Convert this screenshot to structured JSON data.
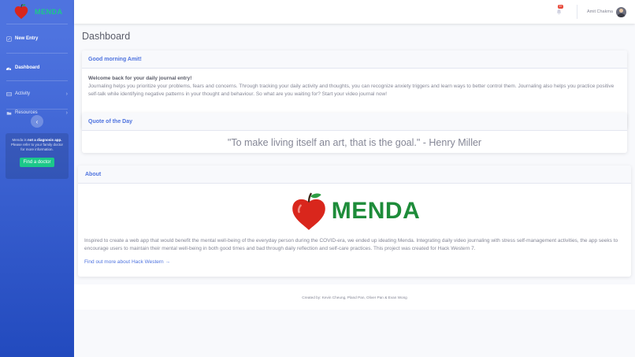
{
  "brand": {
    "name": "MENDA"
  },
  "sidebar": {
    "items": [
      {
        "label": "New Entry",
        "icon": "edit-icon"
      },
      {
        "label": "Dashboard",
        "icon": "tachometer-icon"
      },
      {
        "label": "Activity",
        "icon": "list-icon"
      },
      {
        "label": "Resources",
        "icon": "folder-icon"
      }
    ],
    "notice": {
      "text_prefix": "Menda is ",
      "text_bold": "not a diagnosis app.",
      "text_suffix": " Please refer to your family doctor for more information.",
      "button": "Find a doctor"
    }
  },
  "topbar": {
    "alert_count": "3+",
    "user_name": "Amit Chakma"
  },
  "page": {
    "title": "Dashboard"
  },
  "welcome": {
    "header": "Good morning Amit!",
    "title": "Welcome back for your daily journal entry!",
    "body": "Journaling helps you prioritize your problems, fears and concerns. Through tracking your daily activity and thoughts, you can recognize anxiety triggers and learn ways to better control them. Journaling also helps you practice positive self-talk while identifying negative patterns in your thought and behaviour. So what are you waiting for? Start your video journal now!"
  },
  "quote": {
    "header": "Quote of the Day",
    "text": "\"To make living itself an art, that is the goal.\" - Henry Miller"
  },
  "about": {
    "header": "About",
    "logo_text": "MENDA",
    "body": "Inspired to create a web app that would benefit the mental well-being of the everyday person during the COVID-era, we ended up ideating Menda. Integrating daily video journaling with stress self-management activities, the app seeks to encourage users to maintain their mental well-being in both good times and bad through daily reflection and self-care practices. This project was created for Hack Western 7.",
    "link": "Find out more about Hack Western →"
  },
  "footer": {
    "text": "Created by: Kevin Cheung, Pland Pan, Oliver Pan & Evan Wong"
  },
  "colors": {
    "primary": "#4e73df",
    "success": "#1cc88a",
    "danger": "#e74a3b",
    "logo_green": "#1e8c3a",
    "logo_red": "#d9261c"
  }
}
